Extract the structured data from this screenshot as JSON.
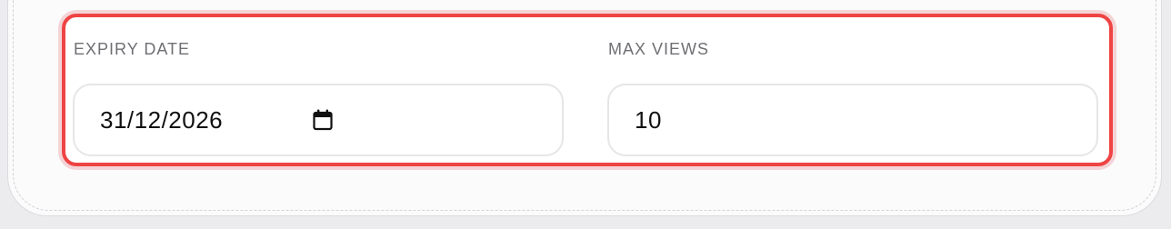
{
  "form": {
    "expiry": {
      "label": "EXPIRY DATE",
      "value": "31/12/2026",
      "icon": "calendar-icon"
    },
    "max_views": {
      "label": "MAX VIEWS",
      "value": "10"
    }
  },
  "colors": {
    "highlight": "#ef4444",
    "label": "#6f6f74",
    "text": "#111111",
    "input_border": "#e6e6e8"
  }
}
